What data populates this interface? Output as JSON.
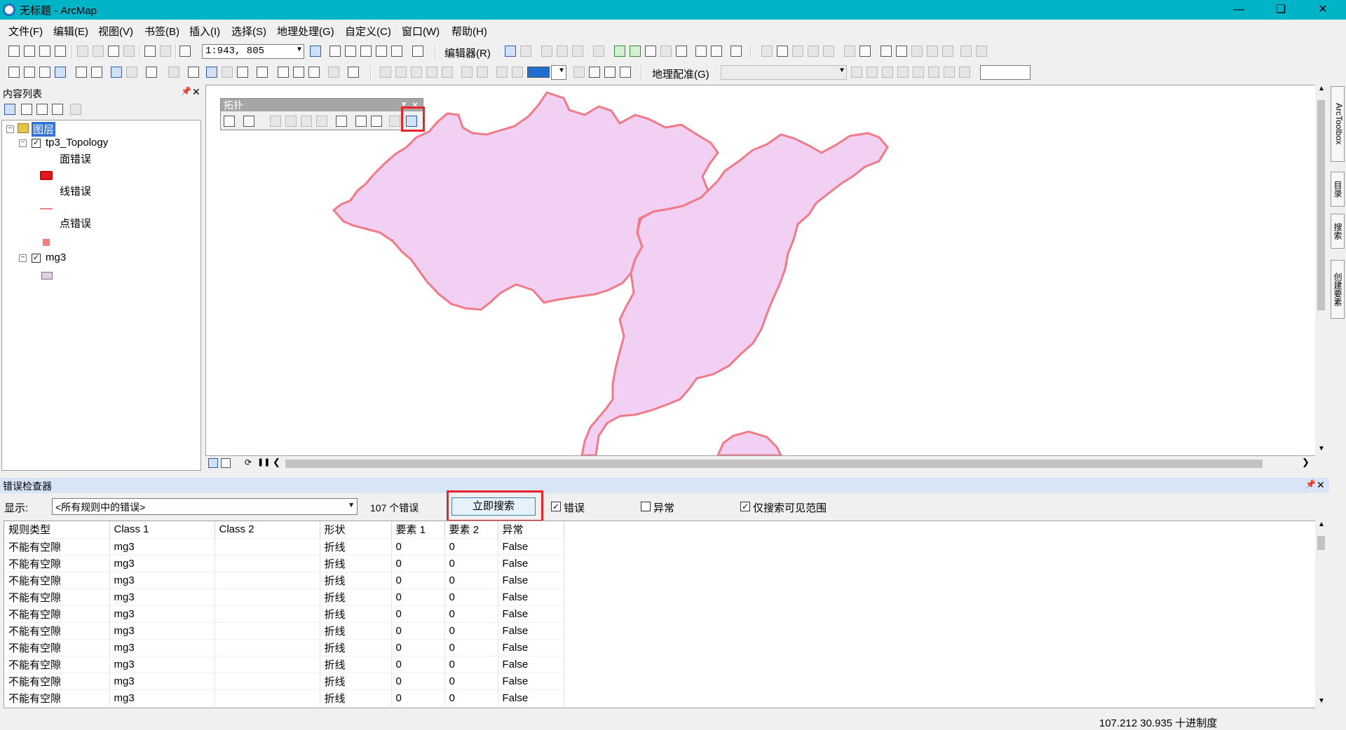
{
  "window": {
    "title": "无标题 - ArcMap"
  },
  "menu": [
    "文件(F)",
    "编辑(E)",
    "视图(V)",
    "书签(B)",
    "插入(I)",
    "选择(S)",
    "地理处理(G)",
    "自定义(C)",
    "窗口(W)",
    "帮助(H)"
  ],
  "toolbar": {
    "scale": "1:943, 805",
    "editor_label": "编辑器(R)",
    "georef_label": "地理配准(G)"
  },
  "toc": {
    "title": "内容列表",
    "root": "图层",
    "layers": [
      {
        "name": "tp3_Topology",
        "items": [
          "面错误",
          "线错误",
          "点错误"
        ]
      },
      {
        "name": "mg3"
      }
    ]
  },
  "topology_toolbar": {
    "title": "拓扑"
  },
  "right_dock": {
    "tabs": [
      "ArcToolbox",
      "目录",
      "搜索",
      "创建要素"
    ]
  },
  "error_inspector": {
    "title": "错误检查器",
    "show_label": "显示:",
    "show_value": "<所有规则中的错误>",
    "count": "107 个错误",
    "search_button": "立即搜索",
    "checkbox_errors": "错误",
    "checkbox_exceptions": "异常",
    "checkbox_visible": "仅搜索可见范围",
    "columns": [
      "规则类型",
      "Class 1",
      "Class 2",
      "形状",
      "要素 1",
      "要素 2",
      "异常"
    ],
    "rows": [
      [
        "不能有空隙",
        "mg3",
        "",
        "折线",
        "0",
        "0",
        "False"
      ],
      [
        "不能有空隙",
        "mg3",
        "",
        "折线",
        "0",
        "0",
        "False"
      ],
      [
        "不能有空隙",
        "mg3",
        "",
        "折线",
        "0",
        "0",
        "False"
      ],
      [
        "不能有空隙",
        "mg3",
        "",
        "折线",
        "0",
        "0",
        "False"
      ],
      [
        "不能有空隙",
        "mg3",
        "",
        "折线",
        "0",
        "0",
        "False"
      ],
      [
        "不能有空隙",
        "mg3",
        "",
        "折线",
        "0",
        "0",
        "False"
      ],
      [
        "不能有空隙",
        "mg3",
        "",
        "折线",
        "0",
        "0",
        "False"
      ],
      [
        "不能有空隙",
        "mg3",
        "",
        "折线",
        "0",
        "0",
        "False"
      ],
      [
        "不能有空隙",
        "mg3",
        "",
        "折线",
        "0",
        "0",
        "False"
      ],
      [
        "不能有空隙",
        "mg3",
        "",
        "折线",
        "0",
        "0",
        "False"
      ]
    ]
  },
  "status": {
    "coords": "107.212  30.935 十进制度"
  },
  "colors": {
    "titlebar": "#00b4c8",
    "polygon_fill": "#f2d0f4",
    "polygon_stroke": "#f07a86",
    "highlight": "#e8242a"
  }
}
